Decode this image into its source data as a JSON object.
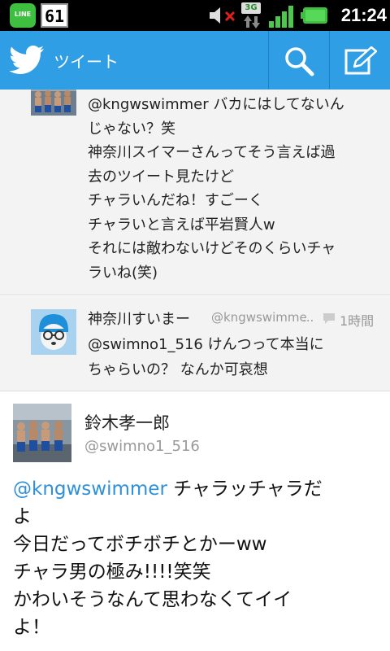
{
  "status_bar": {
    "line_app_label": "LINE",
    "badge_count": "61",
    "network": "3G",
    "time": "21:24"
  },
  "app_bar": {
    "title": "ツイート"
  },
  "timeline": [
    {
      "text": "@kngwswimmer バカにはしてないん\nじゃない？笑\n神奈川スイマーさんってそう言えば過\n去のツイート見たけど\nチャラいんだね！すごーく\nチャラいと言えば平岩賢人w\nそれには敵わないけどそのくらいチャ\nラいね(笑)"
    },
    {
      "name": "神奈川すいまー",
      "handle": "@kngwswimmer",
      "ellipsis": "...",
      "time": "1時間",
      "text": "@swimno1_516 けんつって本当に\nちゃらいの？ なんか可哀想"
    }
  ],
  "focused_tweet": {
    "name": "鈴木孝一郎",
    "handle": "@swimno1_516",
    "mention": "@kngwswimmer",
    "text": " チャラッチャラだ\nよ\n今日だってボチボチとかーww\nチャラ男の極み!!!!笑笑\nかわいそうなんて思わなくてイイ\nよ！"
  },
  "colors": {
    "app_bar": "#2f9ee4",
    "mention": "#2f8fd8",
    "secondary_text": "#999999"
  }
}
